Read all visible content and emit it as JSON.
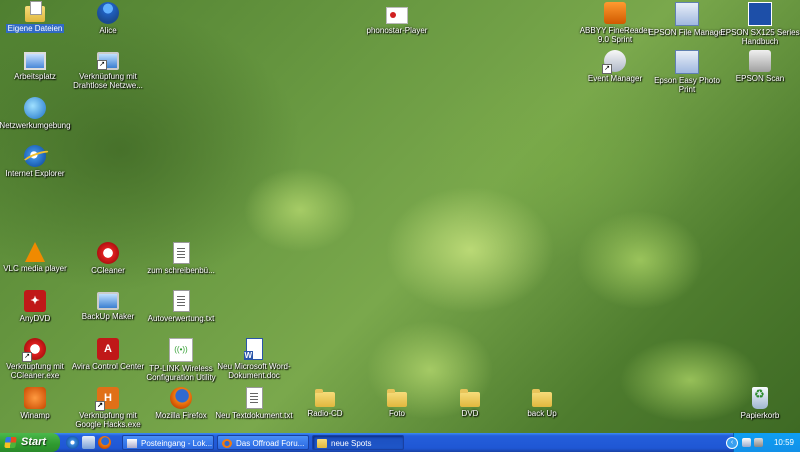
{
  "desktop": {
    "icons": [
      {
        "label": "Eigene Dateien",
        "icon": "my-documents-icon"
      },
      {
        "label": "Alice",
        "icon": "alice-icon"
      },
      {
        "label": "Arbeitsplatz",
        "icon": "my-computer-icon"
      },
      {
        "label": "Verknüpfung mit Drahtlose Netzwe...",
        "icon": "wireless-network-icon"
      },
      {
        "label": "Netzwerkumgebung",
        "icon": "network-places-icon"
      },
      {
        "label": "Internet Explorer",
        "icon": "internet-explorer-icon"
      },
      {
        "label": "VLC media player",
        "icon": "vlc-icon"
      },
      {
        "label": "CCleaner",
        "icon": "ccleaner-icon"
      },
      {
        "label": "zum schreibenbü...",
        "icon": "text-document-icon"
      },
      {
        "label": "AnyDVD",
        "icon": "anydvd-icon"
      },
      {
        "label": "BackUp Maker",
        "icon": "backup-maker-icon"
      },
      {
        "label": "Autoverwertung.txt",
        "icon": "text-document-icon"
      },
      {
        "label": "Verknüpfung mit CCleaner.exe",
        "icon": "ccleaner-icon"
      },
      {
        "label": "Avira Control Center",
        "icon": "avira-icon"
      },
      {
        "label": "TP-LINK Wireless Configuration Utility",
        "icon": "tplink-icon"
      },
      {
        "label": "Neu Microsoft Word-Dokument.doc",
        "icon": "word-document-icon"
      },
      {
        "label": "Winamp",
        "icon": "winamp-icon"
      },
      {
        "label": "Verknüpfung mit Google Hacks.exe",
        "icon": "google-hacks-icon"
      },
      {
        "label": "Mozilla Firefox",
        "icon": "firefox-icon"
      },
      {
        "label": "Neu Textdokument.txt",
        "icon": "text-document-icon"
      },
      {
        "label": "Radio-CD",
        "icon": "folder-icon"
      },
      {
        "label": "Foto",
        "icon": "folder-icon"
      },
      {
        "label": "DVD",
        "icon": "folder-icon"
      },
      {
        "label": "back Up",
        "icon": "folder-icon"
      },
      {
        "label": "phonostar-Player",
        "icon": "phonostar-icon"
      },
      {
        "label": "ABBYY FineReader 9.0 Sprint",
        "icon": "abbyy-icon"
      },
      {
        "label": "EPSON File Manager",
        "icon": "epson-file-manager-icon"
      },
      {
        "label": "EPSON SX125 Series Handbuch",
        "icon": "epson-manual-icon"
      },
      {
        "label": "Event Manager",
        "icon": "event-manager-icon"
      },
      {
        "label": "Epson Easy Photo Print",
        "icon": "epson-photo-print-icon"
      },
      {
        "label": "EPSON Scan",
        "icon": "epson-scan-icon"
      },
      {
        "label": "Papierkorb",
        "icon": "recycle-bin-icon"
      }
    ]
  },
  "taskbar": {
    "start_label": "Start",
    "buttons": [
      {
        "label": "Posteingang - Lok..."
      },
      {
        "label": "Das Offroad Foru..."
      },
      {
        "label": "neue Spots"
      }
    ],
    "clock": "10:59"
  },
  "colors": {
    "selection": "#316ac5",
    "taskbar": "#245edb",
    "start": "#2f9a2f",
    "tray": "#0f9ff3"
  }
}
